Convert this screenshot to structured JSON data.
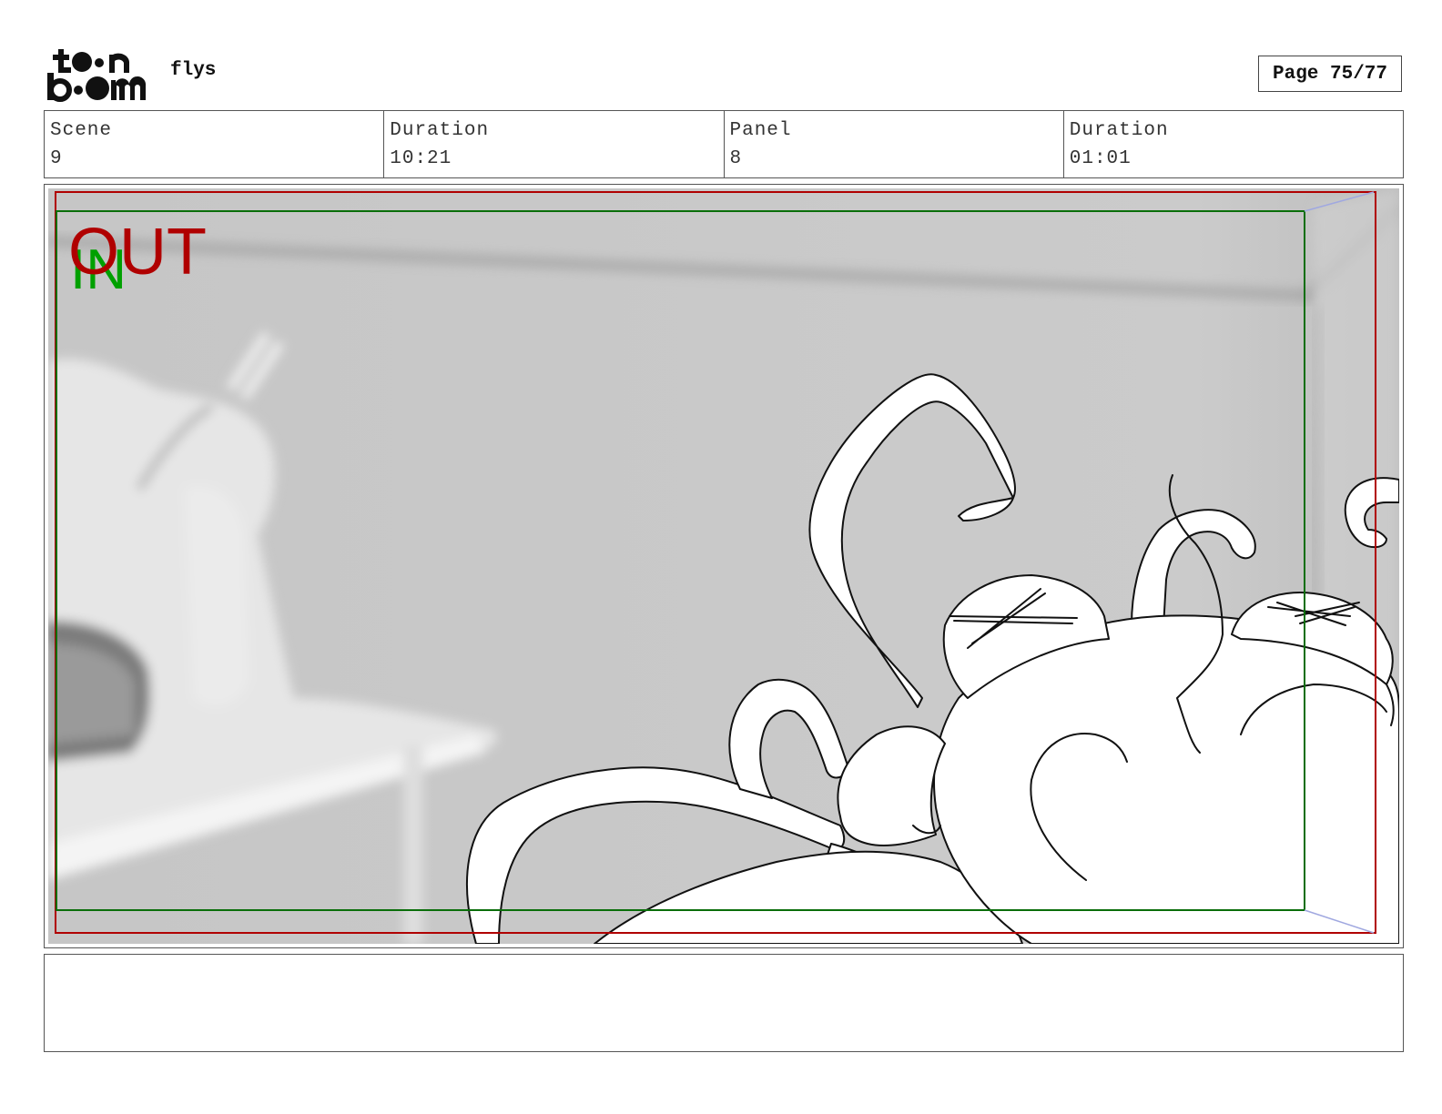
{
  "header": {
    "project_title": "flys",
    "page_label": "Page 75/77"
  },
  "info": {
    "scene_label": "Scene",
    "scene_value": "9",
    "scene_duration_label": "Duration",
    "scene_duration_value": "10:21",
    "panel_label": "Panel",
    "panel_value": "8",
    "panel_duration_label": "Duration",
    "panel_duration_value": "01:01"
  },
  "panel": {
    "out_label": "OUT",
    "in_label": "IN",
    "out_color": "#b00000",
    "in_color": "#00a000",
    "frame_color": "#0a6e0a",
    "background": "#c9c9c9"
  },
  "notes": {
    "text": ""
  }
}
